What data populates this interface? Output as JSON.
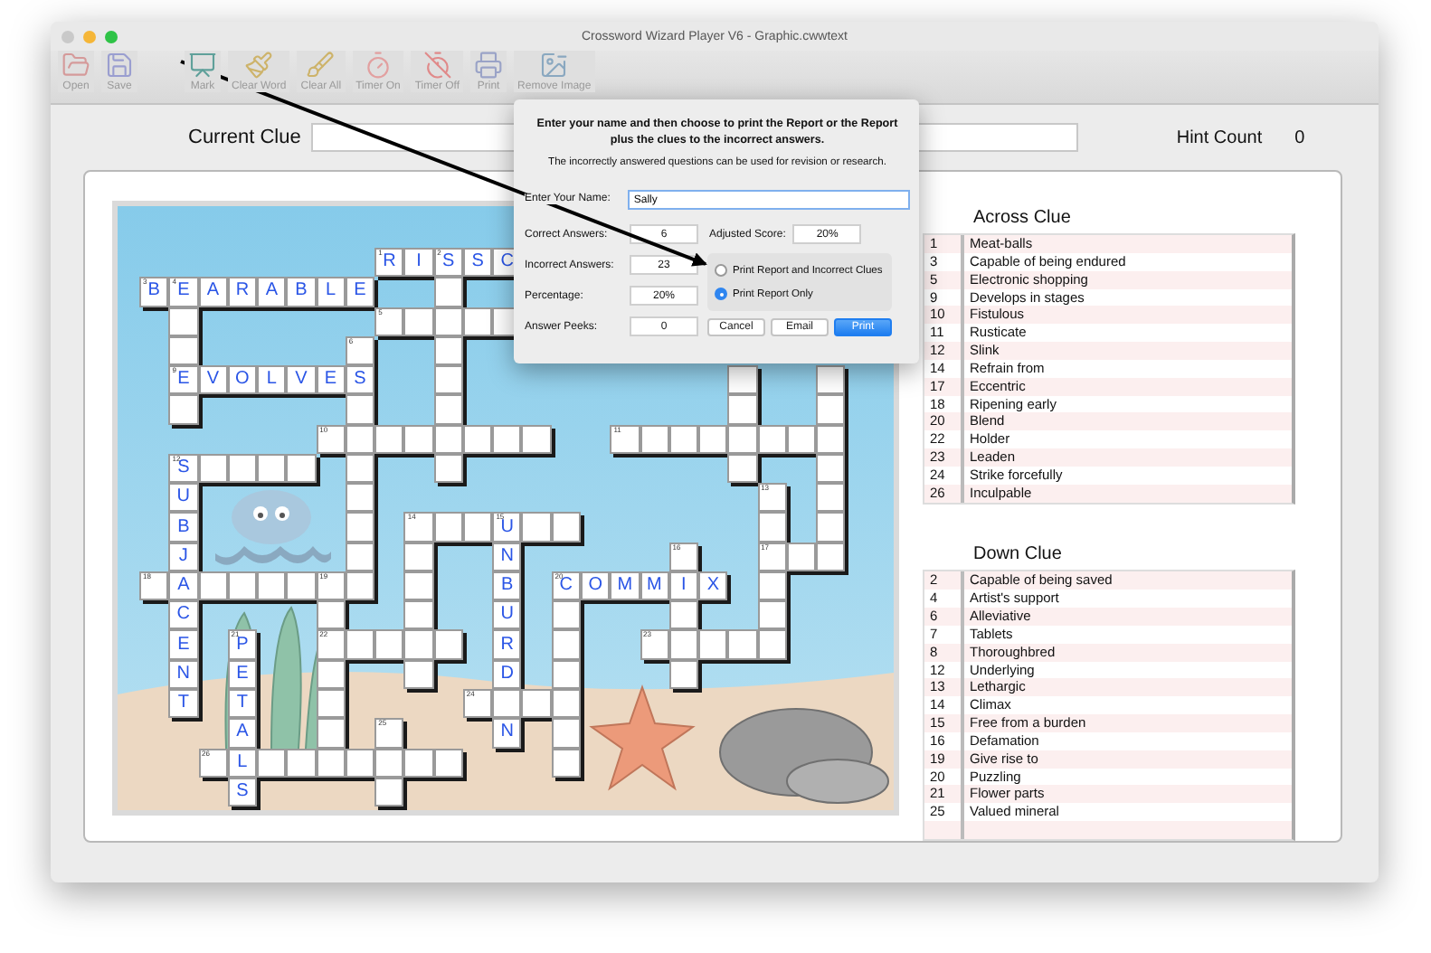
{
  "window": {
    "title": "Crossword Wizard Player V6 - Graphic.cwwtext"
  },
  "toolbar": [
    {
      "items": [
        {
          "label": "Open"
        },
        {
          "label": "Save"
        }
      ]
    },
    {
      "items": [
        {
          "label": "Mark"
        },
        {
          "label": "Clear Word"
        },
        {
          "label": "Clear All"
        },
        {
          "label": "Timer On"
        },
        {
          "label": "Timer Off"
        },
        {
          "label": "Print"
        },
        {
          "label": "Remove Image"
        }
      ]
    }
  ],
  "current_clue": {
    "label": "Current Clue"
  },
  "hint_count": {
    "label": "Hint Count",
    "value": "0"
  },
  "puzzle": {
    "rows": [
      [
        {
          "kind": "block"
        },
        {
          "kind": "block"
        },
        {
          "kind": "block"
        },
        {
          "kind": "block"
        },
        {
          "kind": "block"
        },
        {
          "kind": "block"
        },
        {
          "kind": "block"
        },
        {
          "kind": "block"
        },
        {
          "kind": "cell",
          "letter": "R",
          "number": "1"
        },
        {
          "kind": "cell",
          "letter": "I"
        },
        {
          "kind": "cell",
          "letter": "S",
          "number": "2"
        },
        {
          "kind": "cell",
          "letter": "S"
        },
        {
          "kind": "cell",
          "letter": "C"
        }
      ],
      [
        {
          "kind": "cell",
          "letter": "B",
          "number": "3"
        },
        {
          "kind": "cell",
          "letter": "E",
          "number": "4"
        },
        {
          "kind": "cell",
          "letter": "A"
        },
        {
          "kind": "cell",
          "letter": "R"
        },
        {
          "kind": "cell",
          "letter": "A"
        },
        {
          "kind": "cell",
          "letter": "B"
        },
        {
          "kind": "cell",
          "letter": "L"
        },
        {
          "kind": "cell",
          "letter": "E"
        },
        {
          "kind": "block"
        },
        {
          "kind": "block"
        },
        {
          "kind": "cell"
        }
      ],
      [
        {
          "kind": "block"
        },
        {
          "kind": "cell"
        },
        {
          "kind": "block"
        },
        {
          "kind": "block"
        },
        {
          "kind": "block"
        },
        {
          "kind": "block"
        },
        {
          "kind": "block"
        },
        {
          "kind": "block"
        },
        {
          "kind": "cell",
          "number": "5"
        },
        {
          "kind": "cell"
        },
        {
          "kind": "cell"
        },
        {
          "kind": "cell"
        },
        {
          "kind": "cell"
        }
      ],
      [
        {
          "kind": "block"
        },
        {
          "kind": "cell"
        },
        {
          "kind": "block"
        },
        {
          "kind": "block"
        },
        {
          "kind": "block"
        },
        {
          "kind": "block"
        },
        {
          "kind": "block"
        },
        {
          "kind": "cell",
          "number": "6"
        },
        {
          "kind": "block"
        },
        {
          "kind": "block"
        },
        {
          "kind": "cell"
        }
      ],
      [
        {
          "kind": "block"
        },
        {
          "kind": "cell",
          "letter": "E",
          "number": "9"
        },
        {
          "kind": "cell",
          "letter": "V"
        },
        {
          "kind": "cell",
          "letter": "O"
        },
        {
          "kind": "cell",
          "letter": "L"
        },
        {
          "kind": "cell",
          "letter": "V"
        },
        {
          "kind": "cell",
          "letter": "E"
        },
        {
          "kind": "cell",
          "letter": "S"
        },
        {
          "kind": "block"
        },
        {
          "kind": "block"
        },
        {
          "kind": "cell"
        },
        {
          "kind": "block"
        },
        {
          "kind": "block"
        },
        {
          "kind": "block"
        },
        {
          "kind": "block"
        },
        {
          "kind": "block"
        },
        {
          "kind": "block"
        },
        {
          "kind": "block"
        },
        {
          "kind": "block"
        },
        {
          "kind": "block"
        },
        {
          "kind": "cell"
        },
        {
          "kind": "block"
        },
        {
          "kind": "block"
        },
        {
          "kind": "cell"
        }
      ],
      [
        {
          "kind": "block"
        },
        {
          "kind": "cell"
        },
        {
          "kind": "block"
        },
        {
          "kind": "block"
        },
        {
          "kind": "block"
        },
        {
          "kind": "block"
        },
        {
          "kind": "block"
        },
        {
          "kind": "cell"
        },
        {
          "kind": "block"
        },
        {
          "kind": "block"
        },
        {
          "kind": "cell"
        },
        {
          "kind": "block"
        },
        {
          "kind": "block"
        },
        {
          "kind": "block"
        },
        {
          "kind": "block"
        },
        {
          "kind": "block"
        },
        {
          "kind": "block"
        },
        {
          "kind": "block"
        },
        {
          "kind": "block"
        },
        {
          "kind": "block"
        },
        {
          "kind": "cell"
        },
        {
          "kind": "block"
        },
        {
          "kind": "block"
        },
        {
          "kind": "cell"
        }
      ],
      [
        {
          "kind": "block"
        },
        {
          "kind": "block"
        },
        {
          "kind": "block"
        },
        {
          "kind": "block"
        },
        {
          "kind": "block"
        },
        {
          "kind": "block"
        },
        {
          "kind": "cell",
          "number": "10"
        },
        {
          "kind": "cell"
        },
        {
          "kind": "cell"
        },
        {
          "kind": "cell"
        },
        {
          "kind": "cell"
        },
        {
          "kind": "cell"
        },
        {
          "kind": "cell"
        },
        {
          "kind": "cell"
        },
        {
          "kind": "block"
        },
        {
          "kind": "block"
        },
        {
          "kind": "cell",
          "number": "11"
        },
        {
          "kind": "cell"
        },
        {
          "kind": "cell"
        },
        {
          "kind": "cell"
        },
        {
          "kind": "cell"
        },
        {
          "kind": "cell"
        },
        {
          "kind": "cell"
        },
        {
          "kind": "cell"
        }
      ],
      [
        {
          "kind": "block"
        },
        {
          "kind": "cell",
          "letter": "S",
          "number": "12"
        },
        {
          "kind": "cell"
        },
        {
          "kind": "cell"
        },
        {
          "kind": "cell"
        },
        {
          "kind": "cell"
        },
        {
          "kind": "block"
        },
        {
          "kind": "cell"
        },
        {
          "kind": "block"
        },
        {
          "kind": "block"
        },
        {
          "kind": "cell"
        },
        {
          "kind": "block"
        },
        {
          "kind": "block"
        },
        {
          "kind": "block"
        },
        {
          "kind": "block"
        },
        {
          "kind": "block"
        },
        {
          "kind": "block"
        },
        {
          "kind": "block"
        },
        {
          "kind": "block"
        },
        {
          "kind": "block"
        },
        {
          "kind": "cell"
        },
        {
          "kind": "block"
        },
        {
          "kind": "block"
        },
        {
          "kind": "cell"
        }
      ],
      [
        {
          "kind": "block"
        },
        {
          "kind": "cell",
          "letter": "U"
        },
        {
          "kind": "block"
        },
        {
          "kind": "block"
        },
        {
          "kind": "block"
        },
        {
          "kind": "block"
        },
        {
          "kind": "block"
        },
        {
          "kind": "cell"
        },
        {
          "kind": "block"
        },
        {
          "kind": "block"
        },
        {
          "kind": "block"
        },
        {
          "kind": "block"
        },
        {
          "kind": "block"
        },
        {
          "kind": "block"
        },
        {
          "kind": "block"
        },
        {
          "kind": "block"
        },
        {
          "kind": "block"
        },
        {
          "kind": "block"
        },
        {
          "kind": "block"
        },
        {
          "kind": "block"
        },
        {
          "kind": "block"
        },
        {
          "kind": "cell",
          "number": "13"
        },
        {
          "kind": "block"
        },
        {
          "kind": "cell"
        }
      ],
      [
        {
          "kind": "block"
        },
        {
          "kind": "cell",
          "letter": "B"
        },
        {
          "kind": "block"
        },
        {
          "kind": "block"
        },
        {
          "kind": "block"
        },
        {
          "kind": "block"
        },
        {
          "kind": "block"
        },
        {
          "kind": "cell"
        },
        {
          "kind": "block"
        },
        {
          "kind": "cell",
          "number": "14"
        },
        {
          "kind": "cell"
        },
        {
          "kind": "cell"
        },
        {
          "kind": "cell",
          "letter": "U",
          "number": "15"
        },
        {
          "kind": "cell"
        },
        {
          "kind": "cell"
        },
        {
          "kind": "block"
        },
        {
          "kind": "block"
        },
        {
          "kind": "block"
        },
        {
          "kind": "block"
        },
        {
          "kind": "block"
        },
        {
          "kind": "block"
        },
        {
          "kind": "cell"
        },
        {
          "kind": "block"
        },
        {
          "kind": "cell"
        }
      ],
      [
        {
          "kind": "block"
        },
        {
          "kind": "cell",
          "letter": "J"
        },
        {
          "kind": "block"
        },
        {
          "kind": "block"
        },
        {
          "kind": "block"
        },
        {
          "kind": "block"
        },
        {
          "kind": "block"
        },
        {
          "kind": "cell"
        },
        {
          "kind": "block"
        },
        {
          "kind": "cell"
        },
        {
          "kind": "block"
        },
        {
          "kind": "block"
        },
        {
          "kind": "cell",
          "letter": "N"
        },
        {
          "kind": "block"
        },
        {
          "kind": "block"
        },
        {
          "kind": "block"
        },
        {
          "kind": "block"
        },
        {
          "kind": "block"
        },
        {
          "kind": "cell",
          "number": "16"
        },
        {
          "kind": "block"
        },
        {
          "kind": "block"
        },
        {
          "kind": "cell",
          "number": "17"
        },
        {
          "kind": "cell"
        },
        {
          "kind": "cell"
        }
      ],
      [
        {
          "kind": "cell",
          "number": "18"
        },
        {
          "kind": "cell",
          "letter": "A"
        },
        {
          "kind": "cell"
        },
        {
          "kind": "cell"
        },
        {
          "kind": "cell"
        },
        {
          "kind": "cell"
        },
        {
          "kind": "cell",
          "number": "19"
        },
        {
          "kind": "cell"
        },
        {
          "kind": "block"
        },
        {
          "kind": "cell"
        },
        {
          "kind": "block"
        },
        {
          "kind": "block"
        },
        {
          "kind": "cell",
          "letter": "B"
        },
        {
          "kind": "block"
        },
        {
          "kind": "cell",
          "letter": "C",
          "number": "20"
        },
        {
          "kind": "cell",
          "letter": "O"
        },
        {
          "kind": "cell",
          "letter": "M"
        },
        {
          "kind": "cell",
          "letter": "M"
        },
        {
          "kind": "cell",
          "letter": "I"
        },
        {
          "kind": "cell",
          "letter": "X"
        },
        {
          "kind": "block"
        },
        {
          "kind": "cell"
        }
      ],
      [
        {
          "kind": "block"
        },
        {
          "kind": "cell",
          "letter": "C"
        },
        {
          "kind": "block"
        },
        {
          "kind": "block"
        },
        {
          "kind": "block"
        },
        {
          "kind": "block"
        },
        {
          "kind": "cell"
        },
        {
          "kind": "block"
        },
        {
          "kind": "block"
        },
        {
          "kind": "cell"
        },
        {
          "kind": "block"
        },
        {
          "kind": "block"
        },
        {
          "kind": "cell",
          "letter": "U"
        },
        {
          "kind": "block"
        },
        {
          "kind": "cell"
        },
        {
          "kind": "block"
        },
        {
          "kind": "block"
        },
        {
          "kind": "block"
        },
        {
          "kind": "cell"
        },
        {
          "kind": "block"
        },
        {
          "kind": "block"
        },
        {
          "kind": "cell"
        }
      ],
      [
        {
          "kind": "block"
        },
        {
          "kind": "cell",
          "letter": "E"
        },
        {
          "kind": "block"
        },
        {
          "kind": "cell",
          "letter": "P",
          "number": "21"
        },
        {
          "kind": "block"
        },
        {
          "kind": "block"
        },
        {
          "kind": "cell",
          "number": "22"
        },
        {
          "kind": "cell"
        },
        {
          "kind": "cell"
        },
        {
          "kind": "cell"
        },
        {
          "kind": "cell"
        },
        {
          "kind": "block"
        },
        {
          "kind": "cell",
          "letter": "R"
        },
        {
          "kind": "block"
        },
        {
          "kind": "cell"
        },
        {
          "kind": "block"
        },
        {
          "kind": "block"
        },
        {
          "kind": "cell",
          "number": "23"
        },
        {
          "kind": "cell"
        },
        {
          "kind": "cell"
        },
        {
          "kind": "cell"
        },
        {
          "kind": "cell"
        }
      ],
      [
        {
          "kind": "block"
        },
        {
          "kind": "cell",
          "letter": "N"
        },
        {
          "kind": "block"
        },
        {
          "kind": "cell",
          "letter": "E"
        },
        {
          "kind": "block"
        },
        {
          "kind": "block"
        },
        {
          "kind": "cell"
        },
        {
          "kind": "block"
        },
        {
          "kind": "block"
        },
        {
          "kind": "cell"
        },
        {
          "kind": "block"
        },
        {
          "kind": "block"
        },
        {
          "kind": "cell",
          "letter": "D"
        },
        {
          "kind": "block"
        },
        {
          "kind": "cell"
        },
        {
          "kind": "block"
        },
        {
          "kind": "block"
        },
        {
          "kind": "block"
        },
        {
          "kind": "cell"
        }
      ],
      [
        {
          "kind": "block"
        },
        {
          "kind": "cell",
          "letter": "T"
        },
        {
          "kind": "block"
        },
        {
          "kind": "cell",
          "letter": "T"
        },
        {
          "kind": "block"
        },
        {
          "kind": "block"
        },
        {
          "kind": "cell"
        },
        {
          "kind": "block"
        },
        {
          "kind": "block"
        },
        {
          "kind": "block"
        },
        {
          "kind": "block"
        },
        {
          "kind": "cell",
          "number": "24"
        },
        {
          "kind": "cell"
        },
        {
          "kind": "cell"
        },
        {
          "kind": "cell"
        }
      ],
      [
        {
          "kind": "block"
        },
        {
          "kind": "block"
        },
        {
          "kind": "block"
        },
        {
          "kind": "cell",
          "letter": "A"
        },
        {
          "kind": "block"
        },
        {
          "kind": "block"
        },
        {
          "kind": "cell"
        },
        {
          "kind": "block"
        },
        {
          "kind": "cell",
          "number": "25"
        },
        {
          "kind": "block"
        },
        {
          "kind": "block"
        },
        {
          "kind": "block"
        },
        {
          "kind": "cell",
          "letter": "N"
        },
        {
          "kind": "block"
        },
        {
          "kind": "cell"
        }
      ],
      [
        {
          "kind": "block"
        },
        {
          "kind": "block"
        },
        {
          "kind": "cell",
          "number": "26"
        },
        {
          "kind": "cell",
          "letter": "L"
        },
        {
          "kind": "cell"
        },
        {
          "kind": "cell"
        },
        {
          "kind": "cell"
        },
        {
          "kind": "cell"
        },
        {
          "kind": "cell"
        },
        {
          "kind": "cell"
        },
        {
          "kind": "cell"
        },
        {
          "kind": "block"
        },
        {
          "kind": "block"
        },
        {
          "kind": "block"
        },
        {
          "kind": "cell"
        }
      ],
      [
        {
          "kind": "block"
        },
        {
          "kind": "block"
        },
        {
          "kind": "block"
        },
        {
          "kind": "cell",
          "letter": "S"
        },
        {
          "kind": "block"
        },
        {
          "kind": "block"
        },
        {
          "kind": "block"
        },
        {
          "kind": "block"
        },
        {
          "kind": "cell"
        }
      ]
    ]
  },
  "across_clues": {
    "title": "Across Clue",
    "items": [
      {
        "number": "1",
        "text": "Meat-balls"
      },
      {
        "number": "3",
        "text": "Capable of being endured"
      },
      {
        "number": "5",
        "text": "Electronic shopping"
      },
      {
        "number": "9",
        "text": "Develops in stages"
      },
      {
        "number": "10",
        "text": "Fistulous"
      },
      {
        "number": "11",
        "text": "Rusticate"
      },
      {
        "number": "12",
        "text": "Slink"
      },
      {
        "number": "14",
        "text": "Refrain from"
      },
      {
        "number": "17",
        "text": "Eccentric"
      },
      {
        "number": "18",
        "text": "Ripening early"
      },
      {
        "number": "20",
        "text": "Blend"
      },
      {
        "number": "22",
        "text": "Holder"
      },
      {
        "number": "23",
        "text": "Leaden"
      },
      {
        "number": "24",
        "text": "Strike forcefully"
      },
      {
        "number": "26",
        "text": "Inculpable"
      }
    ]
  },
  "down_clues": {
    "title": "Down Clue",
    "items": [
      {
        "number": "2",
        "text": "Capable of being saved"
      },
      {
        "number": "4",
        "text": "Artist's support"
      },
      {
        "number": "6",
        "text": "Alleviative"
      },
      {
        "number": "7",
        "text": "Tablets"
      },
      {
        "number": "8",
        "text": "Thoroughbred"
      },
      {
        "number": "12",
        "text": "Underlying"
      },
      {
        "number": "13",
        "text": "Lethargic"
      },
      {
        "number": "14",
        "text": "Climax"
      },
      {
        "number": "15",
        "text": "Free from a burden"
      },
      {
        "number": "16",
        "text": "Defamation"
      },
      {
        "number": "19",
        "text": "Give rise to"
      },
      {
        "number": "20",
        "text": "Puzzling"
      },
      {
        "number": "21",
        "text": "Flower parts"
      },
      {
        "number": "25",
        "text": "Valued mineral"
      }
    ]
  },
  "dialog": {
    "heading": "Enter your name and then choose to print the Report or the Report plus the clues to the incorrect answers.",
    "note": "The incorrectly answered questions can be used for revision or research.",
    "name_field": {
      "label": "Enter Your Name:",
      "value": "Sally"
    },
    "fields": [
      {
        "label": "Correct Answers:",
        "value": "6"
      },
      {
        "label": "Incorrect Answers:",
        "value": "23"
      },
      {
        "label": "Percentage:",
        "value": "20%"
      },
      {
        "label": "Answer Peeks:",
        "value": "0"
      }
    ],
    "adjusted_score": {
      "label": "Adjusted Score:",
      "value": "20%"
    },
    "options": [
      {
        "label": "Print Report and Incorrect Clues",
        "selected": false
      },
      {
        "label": "Print Report Only",
        "selected": true
      }
    ],
    "buttons": [
      {
        "label": "Cancel",
        "primary": false
      },
      {
        "label": "Email",
        "primary": false
      },
      {
        "label": "Print",
        "primary": true
      }
    ]
  }
}
